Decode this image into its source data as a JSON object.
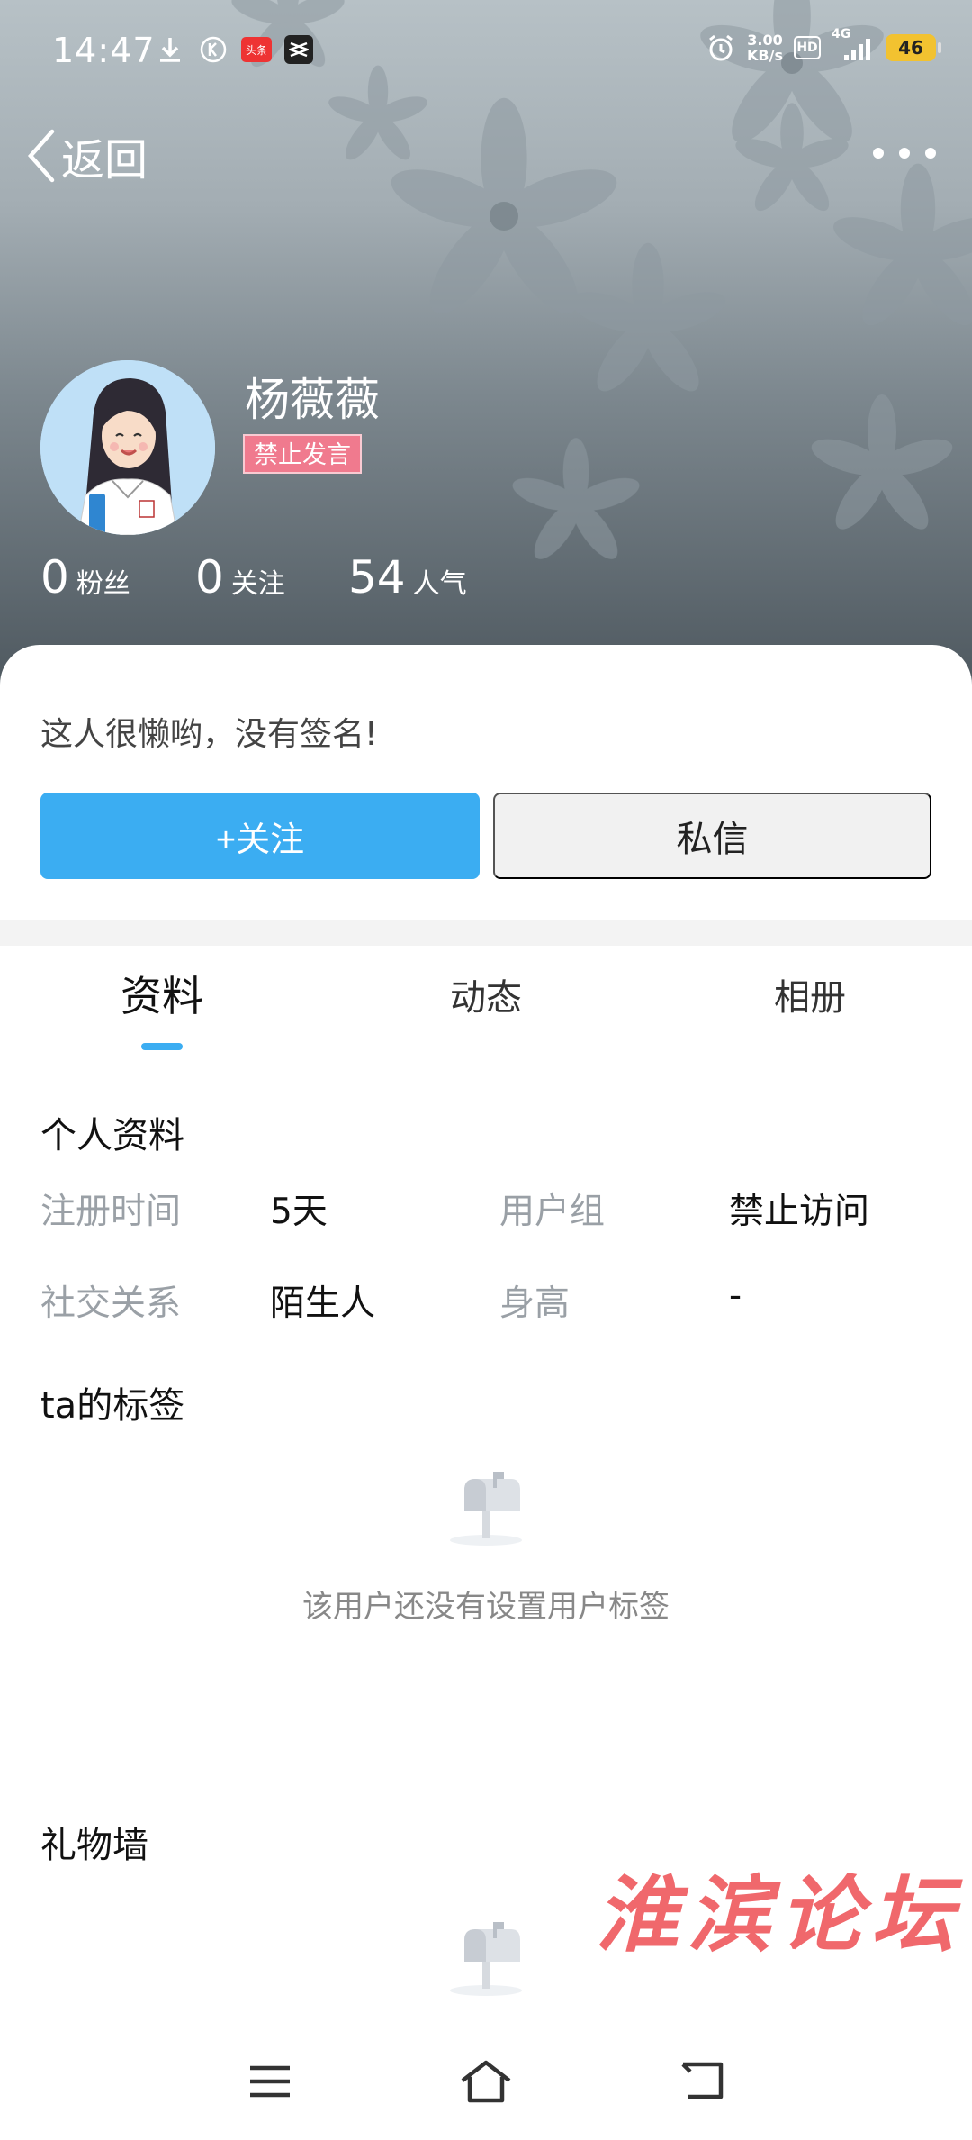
{
  "status_bar": {
    "time": "14:47",
    "speed_value": "3.00",
    "speed_unit": "KB/s",
    "hd": "HD",
    "network": "4G",
    "battery": "46",
    "app_badge": "头条"
  },
  "nav": {
    "back_label": "返回"
  },
  "profile": {
    "name": "杨薇薇",
    "badge": "禁止发言",
    "stats": [
      {
        "num": "0",
        "label": "粉丝"
      },
      {
        "num": "0",
        "label": "关注"
      },
      {
        "num": "54",
        "label": "人气"
      }
    ],
    "signature": "这人很懒哟，没有签名!"
  },
  "actions": {
    "follow": "+关注",
    "message": "私信"
  },
  "tabs": [
    {
      "label": "资料",
      "active": true
    },
    {
      "label": "动态",
      "active": false
    },
    {
      "label": "相册",
      "active": false
    }
  ],
  "personal_info": {
    "title": "个人资料",
    "rows": [
      [
        {
          "label": "注册时间",
          "value": "5天"
        },
        {
          "label": "用户组",
          "value": "禁止访问"
        }
      ],
      [
        {
          "label": "社交关系",
          "value": "陌生人"
        },
        {
          "label": "身高",
          "value": "-"
        }
      ]
    ]
  },
  "tags_section": {
    "title": "ta的标签",
    "empty_text": "该用户还没有设置用户标签"
  },
  "gift_section": {
    "title": "礼物墙"
  },
  "watermark": "淮滨论坛",
  "colors": {
    "accent": "#3badf2",
    "badge": "#f07a8e",
    "watermark": "#f0686c"
  }
}
